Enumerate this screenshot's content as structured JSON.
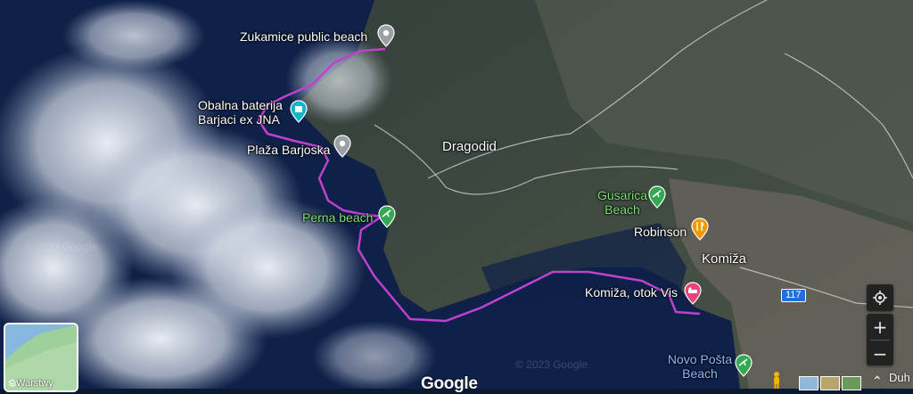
{
  "map": {
    "places": [
      {
        "key": "zukamice",
        "label": "Zukamice public beach"
      },
      {
        "key": "obalna",
        "label": "Obalna baterija Barjaci ex JNA"
      },
      {
        "key": "plaza",
        "label": "Plaža Barjoska"
      },
      {
        "key": "perna",
        "label": "Perna beach"
      },
      {
        "key": "dragodid",
        "label": "Dragodid"
      },
      {
        "key": "gusarica",
        "label": "Gusarica Beach"
      },
      {
        "key": "robinson",
        "label": "Robinson"
      },
      {
        "key": "komiza",
        "label": "Komiža"
      },
      {
        "key": "komiza_otok",
        "label": "Komiža, otok Vis"
      },
      {
        "key": "novo_posta",
        "label": "Novo Pošta Beach"
      }
    ],
    "road_number": "117",
    "watermark": "© 2023 Google",
    "google_logo": "Google",
    "edge_label": "Duh",
    "route_color": "#c040d0"
  },
  "controls": {
    "layers_label": "Warstwy",
    "zoom_in": "+",
    "zoom_out": "−",
    "my_location_icon": "my-location-icon"
  }
}
